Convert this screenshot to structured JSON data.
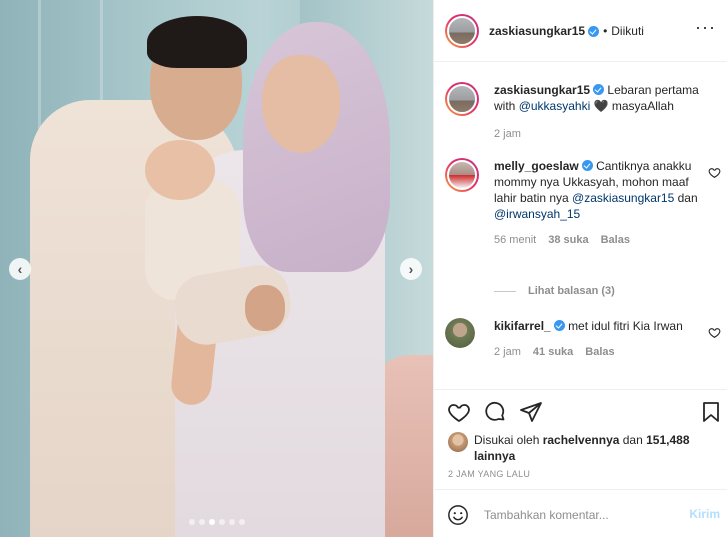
{
  "post": {
    "username": "zaskiasungkar15",
    "follow_separator": "•",
    "follow_label": "Diikuti",
    "more_icon": "more-horizontal-icon"
  },
  "carousel": {
    "slide_count": 6,
    "active_slide": 3,
    "prev_glyph": "‹",
    "next_glyph": "›"
  },
  "caption": {
    "username": "zaskiasungkar15",
    "text_before": "Lebaran pertama with ",
    "mention": "@ukkasyahki",
    "heart_emoji": "🖤",
    "text_after": " masyaAllah",
    "time": "2 jam"
  },
  "comments": [
    {
      "username": "melly_goeslaw",
      "text_1": "Cantiknya anakku mommy nya Ukkasyah, mohon maaf lahir batin nya ",
      "mention_1": "@zaskiasungkar15",
      "text_2": " dan ",
      "mention_2": "@irwansyah_15",
      "time": "56 menit",
      "likes": "38 suka",
      "reply_label": "Balas"
    },
    {
      "username": "kikifarrel_",
      "text": "met idul fitri Kia Irwan",
      "time": "2 jam",
      "likes": "41 suka",
      "reply_label": "Balas"
    }
  ],
  "view_replies": "Lihat balasan (3)",
  "likes": {
    "prefix": "Disukai oleh ",
    "user": "rachelvennya",
    "middle": " dan ",
    "count": "151,488 lainnya"
  },
  "post_time": "2 JAM YANG LALU",
  "comment_box": {
    "placeholder": "Tambahkan komentar...",
    "post_label": "Kirim"
  },
  "colors": {
    "verified": "#3897f0",
    "mention": "#00376b",
    "muted": "#8e8e8e",
    "post_disabled": "#b2dffc"
  }
}
